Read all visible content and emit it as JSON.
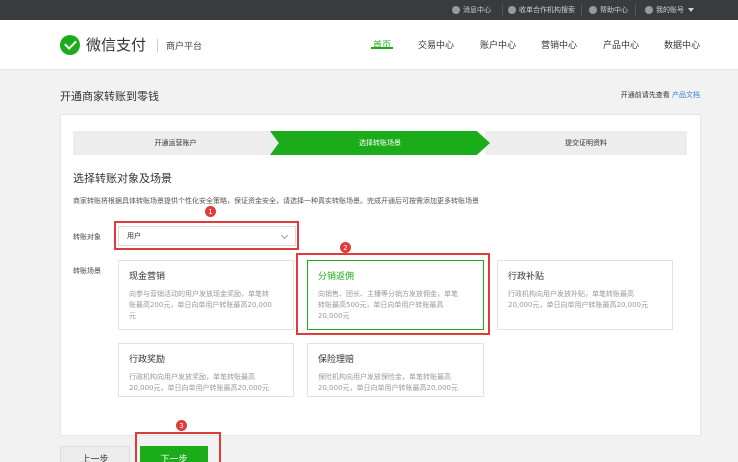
{
  "topbar": {
    "messages": "消息中心",
    "search": "收单合作机构搜索",
    "help": "帮助中心",
    "account": "我的账号"
  },
  "header": {
    "logo": "微信支付",
    "platform": "商户平台",
    "nav": [
      "首页",
      "交易中心",
      "账户中心",
      "营销中心",
      "产品中心",
      "数据中心"
    ],
    "active_nav": "首页"
  },
  "page": {
    "title": "开通商家转账到零钱",
    "hint": "开通前请先查看",
    "hint_link": "产品文档"
  },
  "steps": [
    "开通运营账户",
    "选择转账场景",
    "提交证明资料"
  ],
  "current_step": 2,
  "section": {
    "title": "选择转账对象及场景",
    "desc": "商家转账将根据具体转账场景提供个性化安全策略，保证资金安全，请选择一种真实转账场景。完成开通后可按需添加更多转账场景"
  },
  "form": {
    "target_label": "转账对象",
    "target_value": "用户",
    "scene_label": "转账场景"
  },
  "scenes": [
    {
      "title": "现金营销",
      "desc1": "向参与营销活动的用户发放现金奖励，单笔转",
      "desc2": "账最高200元，单日向单用户转账最高20,000",
      "desc3": "元",
      "selected": false
    },
    {
      "title": "分销返佣",
      "desc1": "向销售、团长、主播等分销方发放佣金，单笔",
      "desc2": "转账最高500元，单日向单用户转账最高",
      "desc3": "20,000元",
      "selected": true
    },
    {
      "title": "行政补贴",
      "desc1": "行政机构向用户发放补贴，单笔转账最高",
      "desc2": "20,000元，单日向单用户转账最高20,000元",
      "desc3": "",
      "selected": false
    },
    {
      "title": "行政奖励",
      "desc1": "行政机构向用户发放奖励，单笔转账最高",
      "desc2": "20,000元，单日向单用户转账最高20,000元",
      "desc3": "",
      "selected": false
    },
    {
      "title": "保险理赔",
      "desc1": "保险机构向用户发放保险金，单笔转账最高",
      "desc2": "20,000元，单日向单用户转账最高20,000元",
      "desc3": "",
      "selected": false
    }
  ],
  "buttons": {
    "prev": "上一步",
    "next": "下一步"
  },
  "annotations": [
    "1",
    "2",
    "3"
  ],
  "colors": {
    "brand": "#1aad19",
    "annotation": "#e13a3a",
    "link": "#3b7bd6",
    "topbar": "#3a3b3f"
  }
}
